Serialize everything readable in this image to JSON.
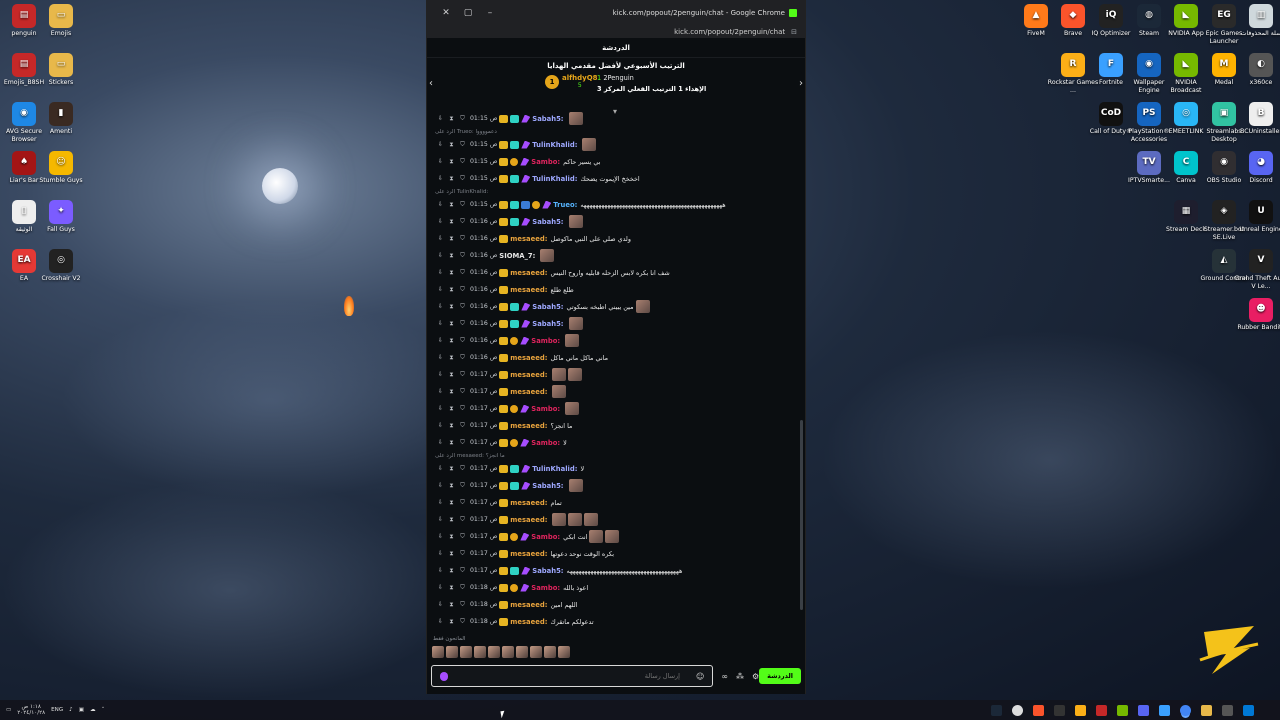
{
  "desktop_left": [
    {
      "label": "penguin",
      "color": "#c62828",
      "glyph": "▤"
    },
    {
      "label": "Emojis",
      "color": "#e8b84a",
      "glyph": "▭"
    },
    {
      "label": "Emojis_B8SH",
      "color": "#c62828",
      "glyph": "▤"
    },
    {
      "label": "Stickers",
      "color": "#e8b84a",
      "glyph": "▭"
    },
    {
      "label": "AVG Secure Browser",
      "color": "#1e88e5",
      "glyph": "◉"
    },
    {
      "label": "Amenti",
      "color": "#3a2a22",
      "glyph": "▮"
    },
    {
      "label": "Liar's Bar",
      "color": "#a31515",
      "glyph": "♠"
    },
    {
      "label": "Stumble Guys",
      "color": "#f5b800",
      "glyph": "☺"
    },
    {
      "label": "الوثيقة",
      "color": "#eeeeee",
      "glyph": "▯"
    },
    {
      "label": "Fall Guys",
      "color": "#7b5cff",
      "glyph": "✦"
    },
    {
      "label": "EA",
      "color": "#e53935",
      "glyph": "EA"
    },
    {
      "label": "Crosshair V2",
      "color": "#222222",
      "glyph": "◎"
    }
  ],
  "desktop_right": [
    {
      "label": "FiveM",
      "color": "#ff7a1a",
      "glyph": "▲"
    },
    {
      "label": "Brave",
      "color": "#fb542b",
      "glyph": "◆"
    },
    {
      "label": "IQ Optimizer",
      "color": "#222222",
      "glyph": "iQ"
    },
    {
      "label": "Steam",
      "color": "#1b2838",
      "glyph": "◍"
    },
    {
      "label": "NVIDIA App",
      "color": "#76b900",
      "glyph": "◣"
    },
    {
      "label": "Epic Games Launcher",
      "color": "#2a2a2a",
      "glyph": "EG"
    },
    {
      "label": "سلة المحذوفات",
      "color": "#cfd8dc",
      "glyph": "▥"
    },
    {
      "label": "Rockstar Games ...",
      "color": "#fcaf17",
      "glyph": "R"
    },
    {
      "label": "Fortnite",
      "color": "#3aa0ff",
      "glyph": "F"
    },
    {
      "label": "Wallpaper Engine",
      "color": "#1565c0",
      "glyph": "◉"
    },
    {
      "label": "NVIDIA Broadcast",
      "color": "#76b900",
      "glyph": "◣"
    },
    {
      "label": "Medal",
      "color": "#ffb300",
      "glyph": "M"
    },
    {
      "label": "x360ce",
      "color": "#555555",
      "glyph": "◐"
    },
    {
      "label": "Call of Duty®",
      "color": "#111111",
      "glyph": "CoD"
    },
    {
      "label": "PlayStation® Accessories",
      "color": "#1565c0",
      "glyph": "PS"
    },
    {
      "label": "EMEETLINK",
      "color": "#29b6f6",
      "glyph": "◎"
    },
    {
      "label": "Streamlabs Desktop",
      "color": "#31c3a2",
      "glyph": "▣"
    },
    {
      "label": "BCUninstaller",
      "color": "#eeeeee",
      "glyph": "B"
    },
    {
      "label": "IPTVSmarte...",
      "color": "#5c6bc0",
      "glyph": "TV"
    },
    {
      "label": "Canva",
      "color": "#00c4cc",
      "glyph": "C"
    },
    {
      "label": "OBS Studio",
      "color": "#302e31",
      "glyph": "◉"
    },
    {
      "label": "Discord",
      "color": "#5865f2",
      "glyph": "◕"
    },
    {
      "label": "Stream Deck",
      "color": "#1e1e2e",
      "glyph": "▦"
    },
    {
      "label": "Streamer.bot SE.Live",
      "color": "#222222",
      "glyph": "◈"
    },
    {
      "label": "Unreal Engine",
      "color": "#111111",
      "glyph": "U"
    },
    {
      "label": "Ground Control",
      "color": "#263238",
      "glyph": "◭"
    },
    {
      "label": "Grand Theft Auto V Le...",
      "color": "#222222",
      "glyph": "V"
    },
    {
      "label": "Rubber Bandits",
      "color": "#e91e63",
      "glyph": "☻"
    }
  ],
  "window": {
    "title": "kick.com/popout/2penguin/chat - Google Chrome",
    "address": "kick.com/popout/2penguin/chat"
  },
  "chat": {
    "header": "الدردشة",
    "pinned_title": "الترتيب الأسبوعي لأفضل مقدمي الهدايا",
    "winner_rank": "1",
    "winner_name": "alfhdyQ8",
    "winner_count": "5",
    "right_count": "1",
    "right_name": "2Penguin",
    "right_line2": "الإهداء 1 الترتيب الفعلي المركز 3"
  },
  "messages": [
    {
      "type": "msg",
      "time": "01:15 ص",
      "badges": [
        "crown",
        "sub",
        "ver"
      ],
      "user": "Sabah5:",
      "color": "#9ea8ff",
      "text": "",
      "emotes": 1
    },
    {
      "type": "reply",
      "text": "الرد على Trueo: دعمووووا"
    },
    {
      "type": "msg",
      "time": "01:15 ص",
      "badges": [
        "crown",
        "sub",
        "ver"
      ],
      "user": "TulinKhalid:",
      "color": "#9ea8ff",
      "text": "",
      "emotes": 1
    },
    {
      "type": "msg",
      "time": "01:15 ص",
      "badges": [
        "crown",
        "num",
        "ver"
      ],
      "user": "Sambo:",
      "color": "#e0245e",
      "text": "بي يسير حاكم",
      "emotes": 0
    },
    {
      "type": "msg",
      "time": "01:15 ص",
      "badges": [
        "crown",
        "sub",
        "ver"
      ],
      "user": "TulinKhalid:",
      "color": "#9ea8ff",
      "text": "اخخخخ الإيموت يضحك",
      "emotes": 0
    },
    {
      "type": "reply",
      "text": "الرد على TulinKhalid:"
    },
    {
      "type": "msg",
      "time": "01:15 ص",
      "badges": [
        "crown",
        "sub",
        "blue",
        "num",
        "ver"
      ],
      "user": "Trueo:",
      "color": "#57b5ff",
      "text": "ههههههههههههههههههههههههههههههههههههههههههههههههه",
      "emotes": 0
    },
    {
      "type": "msg",
      "time": "01:16 ص",
      "badges": [
        "crown",
        "sub",
        "ver"
      ],
      "user": "Sabah5:",
      "color": "#9ea8ff",
      "text": "",
      "emotes": 1
    },
    {
      "type": "msg",
      "time": "01:16 ص",
      "badges": [
        "crown"
      ],
      "user": "mesaeed:",
      "color": "#e8a33d",
      "text": "ولدي صلي على النبي ماكوصل",
      "emotes": 0
    },
    {
      "type": "msg",
      "time": "01:16 ص",
      "badges": [],
      "user": "SIOMA_7:",
      "color": "#e6e6e6",
      "text": "",
      "emotes": 1
    },
    {
      "type": "msg",
      "time": "01:16 ص",
      "badges": [
        "crown"
      ],
      "user": "mesaeed:",
      "color": "#e8a33d",
      "text": "شف انا بكره لابس الزحله قابليه واروح النيس",
      "emotes": 0
    },
    {
      "type": "msg",
      "time": "01:16 ص",
      "badges": [
        "crown"
      ],
      "user": "mesaeed:",
      "color": "#e8a33d",
      "text": "طلع طلع",
      "emotes": 0
    },
    {
      "type": "msg",
      "time": "01:16 ص",
      "badges": [
        "crown",
        "sub",
        "ver"
      ],
      "user": "Sabah5:",
      "color": "#9ea8ff",
      "text": "مين يبيني اطبخه بسكوتي",
      "emotes": 1
    },
    {
      "type": "msg",
      "time": "01:16 ص",
      "badges": [
        "crown",
        "sub",
        "ver"
      ],
      "user": "Sabah5:",
      "color": "#9ea8ff",
      "text": "",
      "emotes": 1
    },
    {
      "type": "msg",
      "time": "01:16 ص",
      "badges": [
        "crown",
        "num",
        "ver"
      ],
      "user": "Sambo:",
      "color": "#e0245e",
      "text": "",
      "emotes": 1
    },
    {
      "type": "msg",
      "time": "01:16 ص",
      "badges": [
        "crown"
      ],
      "user": "mesaeed:",
      "color": "#e8a33d",
      "text": "ماني ماكل ماني ماكل",
      "emotes": 0
    },
    {
      "type": "msg",
      "time": "01:17 ص",
      "badges": [
        "crown"
      ],
      "user": "mesaeed:",
      "color": "#e8a33d",
      "text": "",
      "emotes": 2
    },
    {
      "type": "msg",
      "time": "01:17 ص",
      "badges": [
        "crown"
      ],
      "user": "mesaeed:",
      "color": "#e8a33d",
      "text": "",
      "emotes": 1
    },
    {
      "type": "msg",
      "time": "01:17 ص",
      "badges": [
        "crown",
        "num",
        "ver"
      ],
      "user": "Sambo:",
      "color": "#e0245e",
      "text": "",
      "emotes": 1
    },
    {
      "type": "msg",
      "time": "01:17 ص",
      "badges": [
        "crown"
      ],
      "user": "mesaeed:",
      "color": "#e8a33d",
      "text": "ما انجز؟",
      "emotes": 0
    },
    {
      "type": "msg",
      "time": "01:17 ص",
      "badges": [
        "crown",
        "num",
        "ver"
      ],
      "user": "Sambo:",
      "color": "#e0245e",
      "text": "لا",
      "emotes": 0
    },
    {
      "type": "reply",
      "text": "الرد على mesaeed: ما انجز؟"
    },
    {
      "type": "msg",
      "time": "01:17 ص",
      "badges": [
        "crown",
        "sub",
        "ver"
      ],
      "user": "TulinKhalid:",
      "color": "#9ea8ff",
      "text": "لا",
      "emotes": 0
    },
    {
      "type": "msg",
      "time": "01:17 ص",
      "badges": [
        "crown",
        "sub",
        "ver"
      ],
      "user": "Sabah5:",
      "color": "#9ea8ff",
      "text": "",
      "emotes": 1
    },
    {
      "type": "msg",
      "time": "01:17 ص",
      "badges": [
        "crown"
      ],
      "user": "mesaeed:",
      "color": "#e8a33d",
      "text": "تمام",
      "emotes": 0
    },
    {
      "type": "msg",
      "time": "01:17 ص",
      "badges": [
        "crown"
      ],
      "user": "mesaeed:",
      "color": "#e8a33d",
      "text": "",
      "emotes": 3
    },
    {
      "type": "msg",
      "time": "01:17 ص",
      "badges": [
        "crown",
        "num",
        "ver"
      ],
      "user": "Sambo:",
      "color": "#e0245e",
      "text": "انت ابكي",
      "emotes": 2
    },
    {
      "type": "msg",
      "time": "01:17 ص",
      "badges": [
        "crown"
      ],
      "user": "mesaeed:",
      "color": "#e8a33d",
      "text": "بكره الوقت نوحد دعوتها",
      "emotes": 0
    },
    {
      "type": "msg",
      "time": "01:17 ص",
      "badges": [
        "crown",
        "sub",
        "ver"
      ],
      "user": "Sabah5:",
      "color": "#9ea8ff",
      "text": "ههههههههههههههههههههههههههههههههههههههه",
      "emotes": 0
    },
    {
      "type": "msg",
      "time": "01:18 ص",
      "badges": [
        "crown",
        "num",
        "ver"
      ],
      "user": "Sambo:",
      "color": "#e0245e",
      "text": "اعوذ بالله",
      "emotes": 0
    },
    {
      "type": "msg",
      "time": "01:18 ص",
      "badges": [
        "crown"
      ],
      "user": "mesaeed:",
      "color": "#e8a33d",
      "text": "اللهم امين",
      "emotes": 0
    },
    {
      "type": "msg",
      "time": "01:18 ص",
      "badges": [
        "crown"
      ],
      "user": "mesaeed:",
      "color": "#e8a33d",
      "text": "تدعولكم ماتقرك",
      "emotes": 0
    }
  ],
  "guests": {
    "label": "المانحون فقط"
  },
  "input": {
    "placeholder": "إرسال رسالة",
    "send_label": "الدردشة"
  },
  "taskbar": {
    "lang": "ENG",
    "time": "١:١٨ ص",
    "date": "٢٠٢٤/١٠/٢٨"
  }
}
